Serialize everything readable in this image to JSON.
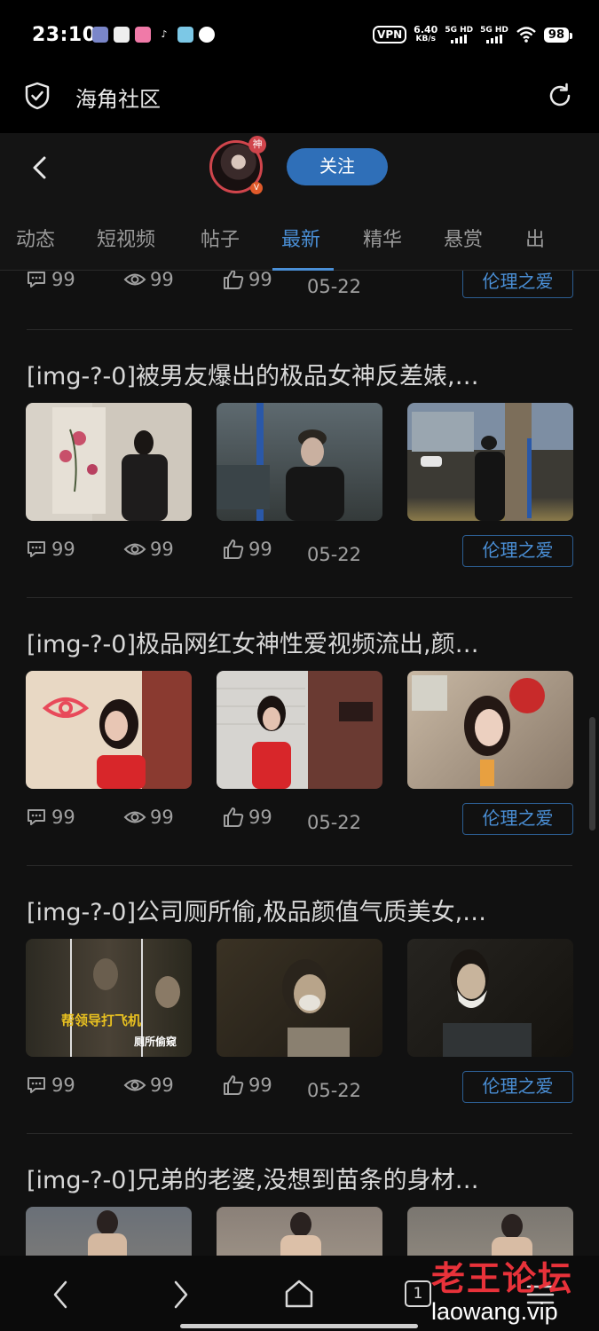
{
  "status_bar": {
    "time": "23:10",
    "vpn": "VPN",
    "speed_value": "6.40",
    "speed_unit": "KB/s",
    "sim1": "5G HD",
    "sim2": "5G HD",
    "battery": "98"
  },
  "app_bar": {
    "title": "海角社区"
  },
  "profile": {
    "badge_top": "神",
    "badge_bottom": "V",
    "follow_label": "关注"
  },
  "tabs": [
    {
      "label": "动态",
      "active": false
    },
    {
      "label": "短视频",
      "active": false
    },
    {
      "label": "帖子",
      "active": false
    },
    {
      "label": "最新",
      "active": true
    },
    {
      "label": "精华",
      "active": false
    },
    {
      "label": "悬赏",
      "active": false
    },
    {
      "label": "出",
      "active": false
    }
  ],
  "feed": {
    "first_stats": {
      "comments": "99",
      "views": "99",
      "likes": "99",
      "date": "05-22",
      "tag": "伦理之爱"
    },
    "posts": [
      {
        "title": "[img-?-0]被男友爆出的极品女神反差婊,…",
        "comments": "99",
        "views": "99",
        "likes": "99",
        "date": "05-22",
        "tag": "伦理之爱",
        "images": [
          "woman-in-black-before-floral-painting",
          "woman-in-black-cap-street-night",
          "woman-walking-past-tree-street"
        ]
      },
      {
        "title": "[img-?-0]极品网红女神性爱视频流出,颜…",
        "comments": "99",
        "views": "99",
        "likes": "99",
        "date": "05-22",
        "tag": "伦理之爱",
        "images": [
          "woman-in-red-top-neon-eye",
          "woman-in-red-top-white-tiles",
          "woman-portrait-red-decor"
        ]
      },
      {
        "title": "[img-?-0]公司厕所偷,极品颜值气质美女,…",
        "comments": "99",
        "views": "99",
        "likes": "99",
        "date": "05-22",
        "tag": "伦理之爱",
        "images": [
          "dark-video-collage",
          "dark-video-frame-woman",
          "dark-video-frame-masked-woman"
        ],
        "overlay_texts": [
          "帮领导打飞机",
          "厕所偷窥"
        ]
      },
      {
        "title": "[img-?-0]兄弟的老婆,没想到苗条的身材…",
        "images": [
          "woman-on-couch-1",
          "woman-on-couch-2",
          "woman-on-couch-3"
        ]
      }
    ]
  },
  "nav_bar": {
    "tab_count": "1"
  },
  "watermark": {
    "name": "老王论坛",
    "url": "laowang.vip"
  },
  "colors": {
    "accent": "#4a8fd6",
    "follow_button": "#2f6fb8",
    "avatar_ring": "#d0454c",
    "watermark_red": "#e8323a"
  }
}
